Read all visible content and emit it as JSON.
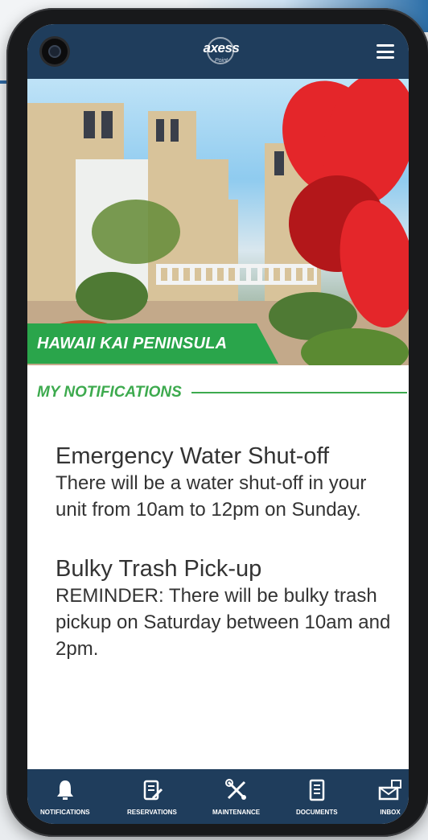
{
  "app": {
    "logo_text": "axess",
    "logo_sub": "Point"
  },
  "hero": {
    "property_name": "HAWAII KAI PENINSULA"
  },
  "notifications": {
    "section_title": "MY NOTIFICATIONS",
    "items": [
      {
        "title": "Emergency Water Shut-off",
        "body": "There will be a water shut-off in your unit from 10am to 12pm on Sunday."
      },
      {
        "title": "Bulky Trash Pick-up",
        "body": "REMINDER: There will be bulky trash pickup on Saturday between 10am and 2pm."
      }
    ]
  },
  "tabbar": {
    "tabs": [
      {
        "label": "NOTIFICATIONS",
        "icon": "bell-icon"
      },
      {
        "label": "RESERVATIONS",
        "icon": "clipboard-pen-icon"
      },
      {
        "label": "MAINTENANCE",
        "icon": "tools-icon"
      },
      {
        "label": "DOCUMENTS",
        "icon": "document-icon"
      },
      {
        "label": "INBOX",
        "icon": "inbox-icon"
      }
    ]
  },
  "colors": {
    "header_bg": "#1f3d5c",
    "accent_green": "#2aa54b",
    "section_green": "#3daa4e",
    "text_dark": "#333333"
  }
}
